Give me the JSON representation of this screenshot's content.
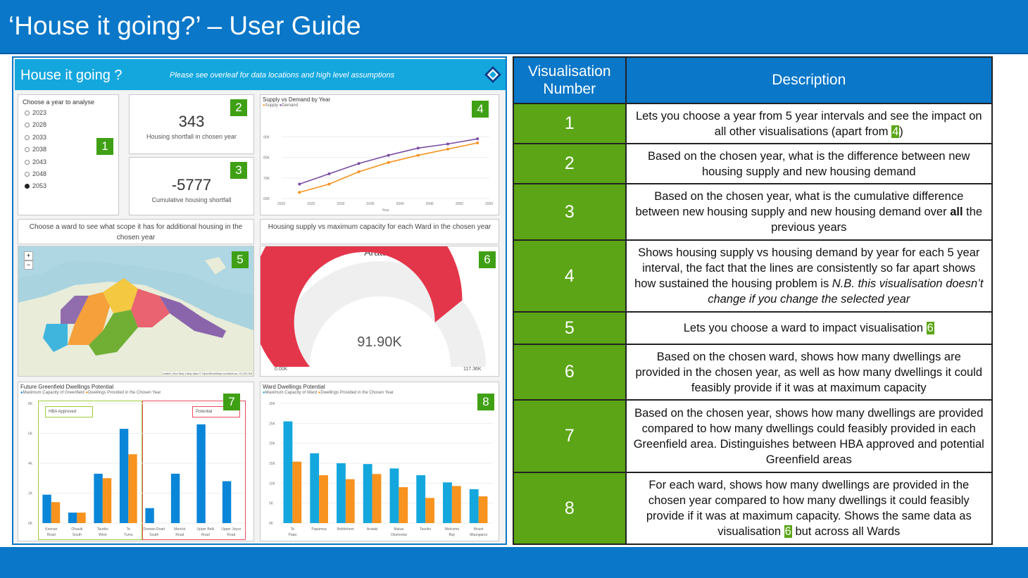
{
  "page": {
    "title": "‘House it going?’ – User Guide"
  },
  "dashboard": {
    "title": "House it going ?",
    "note": "Please see overleaf for data locations and high level assumptions",
    "year_slicer": {
      "title": "Choose a year to analyse",
      "options": [
        "2023",
        "2028",
        "2033",
        "2038",
        "2043",
        "2048",
        "2053"
      ],
      "selected": "2053"
    },
    "kpi_shortfall": {
      "value": "343",
      "label": "Housing shortfall in chosen year"
    },
    "kpi_cumulative": {
      "value": "-5777",
      "label": "Cumulative housing shortfall"
    },
    "supply_demand_chart": {
      "title": "Supply vs Demand by Year",
      "legend": [
        "Supply",
        "Demand"
      ],
      "xlabel": "Year",
      "x_ticks": [
        "2020",
        "2025",
        "2030",
        "2035",
        "2040",
        "2045",
        "2050",
        "2055"
      ],
      "y_ticks": [
        "60K",
        "70K",
        "80K",
        "90K"
      ]
    },
    "ward_prompt": "Choose a ward to see what scope it has for additional housing in the chosen year",
    "gauge_title": "Housing supply vs maximum capacity for each Ward in the chosen year",
    "gauge": {
      "ward": "Arataki",
      "value": "91.90K",
      "min": "0.00K",
      "max": "117.36K",
      "fraction": 0.783
    },
    "map_attribution": "Leaflet | Esri Map | Map data © OpenStreetMap contributors, CC-BY-SA",
    "greenfield_chart": {
      "title": "Future Greenfield Dwellings Potential",
      "legend": [
        "Maximum Capacity of Greenfield",
        "Dwellings Provided in the Chosen Year"
      ],
      "group_labels": [
        "HBA Approved",
        "Potential"
      ],
      "y_ticks": [
        "0K",
        "2K",
        "4K",
        "6K",
        "8K"
      ]
    },
    "ward_chart": {
      "title": "Ward Dwellings Potential",
      "legend": [
        "Maximum Capacity of Ward",
        "Dwellings Provided in the Chosen Year"
      ],
      "y_ticks": [
        "0K",
        "5K",
        "10K",
        "15K",
        "20K",
        "25K",
        "30K"
      ]
    },
    "badges": [
      "1",
      "2",
      "3",
      "4",
      "5",
      "6",
      "7",
      "8"
    ]
  },
  "chart_data": [
    {
      "type": "line",
      "title": "Supply vs Demand by Year",
      "xlabel": "Year",
      "x": [
        2023,
        2028,
        2033,
        2038,
        2043,
        2048,
        2053
      ],
      "xlim": [
        2020,
        2055
      ],
      "ylim": [
        60000,
        100000
      ],
      "series": [
        {
          "name": "Supply",
          "color": "#f7931e",
          "values": [
            63000,
            67000,
            73000,
            77500,
            81000,
            84000,
            87000
          ]
        },
        {
          "name": "Demand",
          "color": "#7a4ea3",
          "values": [
            67000,
            72000,
            77000,
            81000,
            84500,
            86500,
            89000
          ]
        }
      ]
    },
    {
      "type": "bar",
      "title": "Future Greenfield Dwellings Potential",
      "categories": [
        "Keenan Road",
        "Ohauiti South",
        "Tauriko West",
        "Te Tumu",
        "Domain Road South",
        "Merrick Road",
        "Upper Belk Road",
        "Upper Joyce Road"
      ],
      "ylim": [
        0,
        8000
      ],
      "series": [
        {
          "name": "Maximum Capacity of Greenfield",
          "color": "#0a86d9",
          "values": [
            1900,
            700,
            3300,
            6300,
            1000,
            3300,
            6600,
            2800
          ]
        },
        {
          "name": "Dwellings Provided in the Chosen Year",
          "color": "#f7931e",
          "values": [
            1400,
            700,
            3000,
            4600,
            0,
            0,
            0,
            0
          ]
        }
      ]
    },
    {
      "type": "bar",
      "title": "Ward Dwellings Potential",
      "categories": [
        "Te Papa",
        "Papamoa",
        "Bethlehem",
        "Arataki",
        "Matua Otumoetai",
        "Tauriko",
        "Welcome Bay",
        "Mount Maunganui"
      ],
      "ylim": [
        0,
        30000
      ],
      "series": [
        {
          "name": "Maximum Capacity of Ward",
          "color": "#14a7de",
          "values": [
            25500,
            17500,
            15000,
            14800,
            13700,
            12000,
            10200,
            8500
          ]
        },
        {
          "name": "Dwellings Provided in the Chosen Year",
          "color": "#f7931e",
          "values": [
            15400,
            12000,
            11000,
            12300,
            9000,
            6300,
            9300,
            6700
          ]
        }
      ]
    }
  ],
  "table": {
    "headers": [
      "Visualisation Number",
      "Description"
    ],
    "rows": [
      {
        "num": "1",
        "pre": "Lets you choose a year from 5 year intervals and see the impact on all other visualisations (apart from ",
        "hl": "4",
        "post": ")"
      },
      {
        "num": "2",
        "text": "Based on the chosen year, what is the difference between new housing supply and new housing demand"
      },
      {
        "num": "3",
        "pre": "Based on the chosen year, what is the cumulative difference between new housing supply and new housing demand over ",
        "bold": "all",
        "post": " the previous years"
      },
      {
        "num": "4",
        "pre": "Shows housing supply vs housing demand by year for each 5 year interval, the fact that the lines are consistently so far apart shows how sustained the housing problem is ",
        "italic": "N.B. this visualisation doesn’t change if you change the selected year"
      },
      {
        "num": "5",
        "pre": "Lets you choose a ward to impact visualisation ",
        "hl": "6"
      },
      {
        "num": "6",
        "text": "Based on the chosen ward, shows how many dwellings are provided in the chosen year, as well as how many dwellings it could feasibly provide if it was at maximum capacity"
      },
      {
        "num": "7",
        "text": "Based on the chosen year, shows how many dwellings are provided compared to how many dwellings could feasibly provided in each Greenfield area. Distinguishes between HBA approved and potential Greenfield areas"
      },
      {
        "num": "8",
        "pre": "For each ward, shows how many dwellings are provided in the chosen year compared to how many dwellings it could feasibly provide if it was at maximum capacity. Shows the same data as visualisation ",
        "hl": "6",
        "post": " but across all Wards"
      }
    ]
  }
}
